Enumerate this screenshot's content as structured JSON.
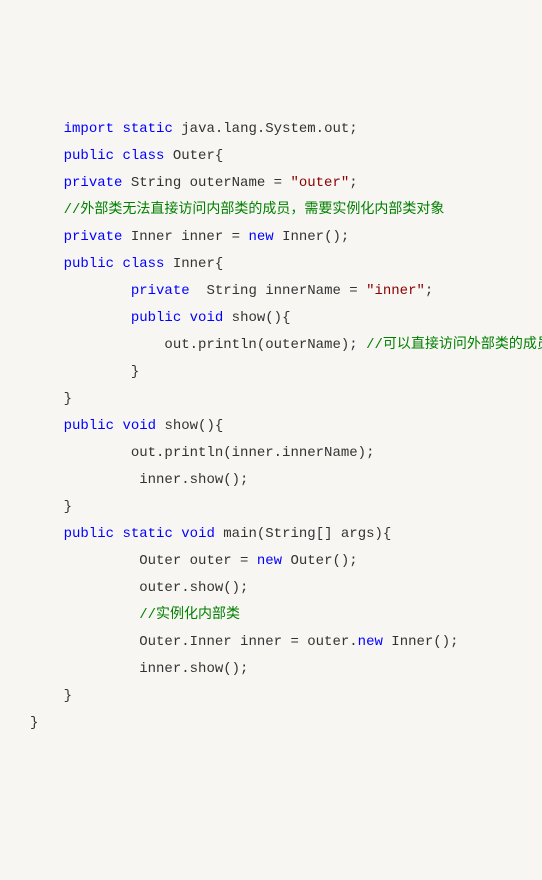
{
  "code": {
    "lines": [
      {
        "indent": 1,
        "tokens": [
          {
            "t": "kw",
            "v": "import"
          },
          {
            "t": "plain",
            "v": " "
          },
          {
            "t": "kw",
            "v": "static"
          },
          {
            "t": "plain",
            "v": " java.lang.System.out;"
          }
        ]
      },
      {
        "indent": 1,
        "tokens": [
          {
            "t": "kw",
            "v": "public"
          },
          {
            "t": "plain",
            "v": " "
          },
          {
            "t": "kw",
            "v": "class"
          },
          {
            "t": "plain",
            "v": " Outer{"
          }
        ]
      },
      {
        "indent": 1,
        "tokens": [
          {
            "t": "kw",
            "v": "private"
          },
          {
            "t": "plain",
            "v": " String outerName = "
          },
          {
            "t": "str",
            "v": "\"outer\""
          },
          {
            "t": "plain",
            "v": ";"
          }
        ]
      },
      {
        "indent": 1,
        "tokens": [
          {
            "t": "cmt",
            "v": "//外部类无法直接访问内部类的成员，需要实例化内部类对象"
          }
        ]
      },
      {
        "indent": 1,
        "tokens": [
          {
            "t": "kw",
            "v": "private"
          },
          {
            "t": "plain",
            "v": " Inner inner = "
          },
          {
            "t": "kw",
            "v": "new"
          },
          {
            "t": "plain",
            "v": " Inner();"
          }
        ]
      },
      {
        "indent": 1,
        "tokens": [
          {
            "t": "kw",
            "v": "public"
          },
          {
            "t": "plain",
            "v": " "
          },
          {
            "t": "kw",
            "v": "class"
          },
          {
            "t": "plain",
            "v": " Inner{"
          }
        ]
      },
      {
        "indent": 3,
        "tokens": [
          {
            "t": "kw",
            "v": "private"
          },
          {
            "t": "plain",
            "v": "  String innerName = "
          },
          {
            "t": "str",
            "v": "\"inner\""
          },
          {
            "t": "plain",
            "v": ";"
          }
        ]
      },
      {
        "indent": 3,
        "tokens": [
          {
            "t": "kw",
            "v": "public"
          },
          {
            "t": "plain",
            "v": " "
          },
          {
            "t": "kw",
            "v": "void"
          },
          {
            "t": "plain",
            "v": " show(){"
          }
        ]
      },
      {
        "indent": 4,
        "tokens": [
          {
            "t": "plain",
            "v": "out.println(outerName); "
          },
          {
            "t": "cmt",
            "v": "//可以直接访问外部类的成员"
          }
        ]
      },
      {
        "indent": 3,
        "tokens": [
          {
            "t": "plain",
            "v": "}"
          }
        ]
      },
      {
        "indent": 1,
        "tokens": [
          {
            "t": "plain",
            "v": "}"
          }
        ]
      },
      {
        "indent": 1,
        "tokens": [
          {
            "t": "kw",
            "v": "public"
          },
          {
            "t": "plain",
            "v": " "
          },
          {
            "t": "kw",
            "v": "void"
          },
          {
            "t": "plain",
            "v": " show(){"
          }
        ]
      },
      {
        "indent": 3,
        "tokens": [
          {
            "t": "plain",
            "v": "out.println(inner.innerName);"
          }
        ]
      },
      {
        "indent": 3,
        "tokens": [
          {
            "t": "plain",
            "v": " inner.show();"
          }
        ]
      },
      {
        "indent": 1,
        "tokens": [
          {
            "t": "plain",
            "v": "}"
          }
        ]
      },
      {
        "indent": 1,
        "tokens": [
          {
            "t": "kw",
            "v": "public"
          },
          {
            "t": "plain",
            "v": " "
          },
          {
            "t": "kw",
            "v": "static"
          },
          {
            "t": "plain",
            "v": " "
          },
          {
            "t": "kw",
            "v": "void"
          },
          {
            "t": "plain",
            "v": " main(String[] args){"
          }
        ]
      },
      {
        "indent": 3,
        "tokens": [
          {
            "t": "plain",
            "v": " Outer outer = "
          },
          {
            "t": "kw",
            "v": "new"
          },
          {
            "t": "plain",
            "v": " Outer();"
          }
        ]
      },
      {
        "indent": 3,
        "tokens": [
          {
            "t": "plain",
            "v": " outer.show();"
          }
        ]
      },
      {
        "indent": 3,
        "tokens": [
          {
            "t": "plain",
            "v": " "
          },
          {
            "t": "cmt",
            "v": "//实例化内部类"
          }
        ]
      },
      {
        "indent": 3,
        "tokens": [
          {
            "t": "plain",
            "v": " Outer.Inner inner = outer."
          },
          {
            "t": "kw",
            "v": "new"
          },
          {
            "t": "plain",
            "v": " Inner();"
          }
        ]
      },
      {
        "indent": 3,
        "tokens": [
          {
            "t": "plain",
            "v": " inner.show();"
          }
        ]
      },
      {
        "indent": 1,
        "tokens": [
          {
            "t": "plain",
            "v": "}"
          }
        ]
      },
      {
        "indent": 0,
        "tokens": [
          {
            "t": "plain",
            "v": "}"
          }
        ]
      }
    ]
  }
}
